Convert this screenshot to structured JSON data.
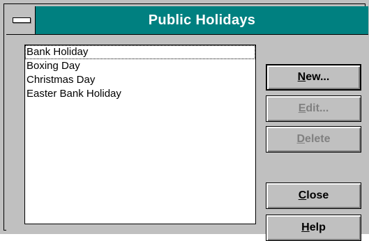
{
  "window": {
    "title": "Public Holidays"
  },
  "list": {
    "items": [
      {
        "label": "Bank Holiday",
        "focused": true
      },
      {
        "label": "Boxing Day",
        "focused": false
      },
      {
        "label": "Christmas Day",
        "focused": false
      },
      {
        "label": "Easter Bank Holiday",
        "focused": false
      }
    ]
  },
  "buttons": {
    "new": {
      "mnemonic": "N",
      "rest": "ew...",
      "enabled": true
    },
    "edit": {
      "mnemonic": "E",
      "rest": "dit...",
      "enabled": false
    },
    "delete": {
      "mnemonic": "D",
      "rest": "elete",
      "enabled": false
    },
    "close": {
      "mnemonic": "C",
      "rest": "lose",
      "enabled": true
    },
    "help": {
      "mnemonic": "H",
      "rest": "elp",
      "enabled": true
    }
  },
  "colors": {
    "titlebar": "#008080",
    "face": "#c0c0c0",
    "disabled_text": "#808080"
  },
  "icons": {
    "system_menu": "system-menu-icon"
  }
}
